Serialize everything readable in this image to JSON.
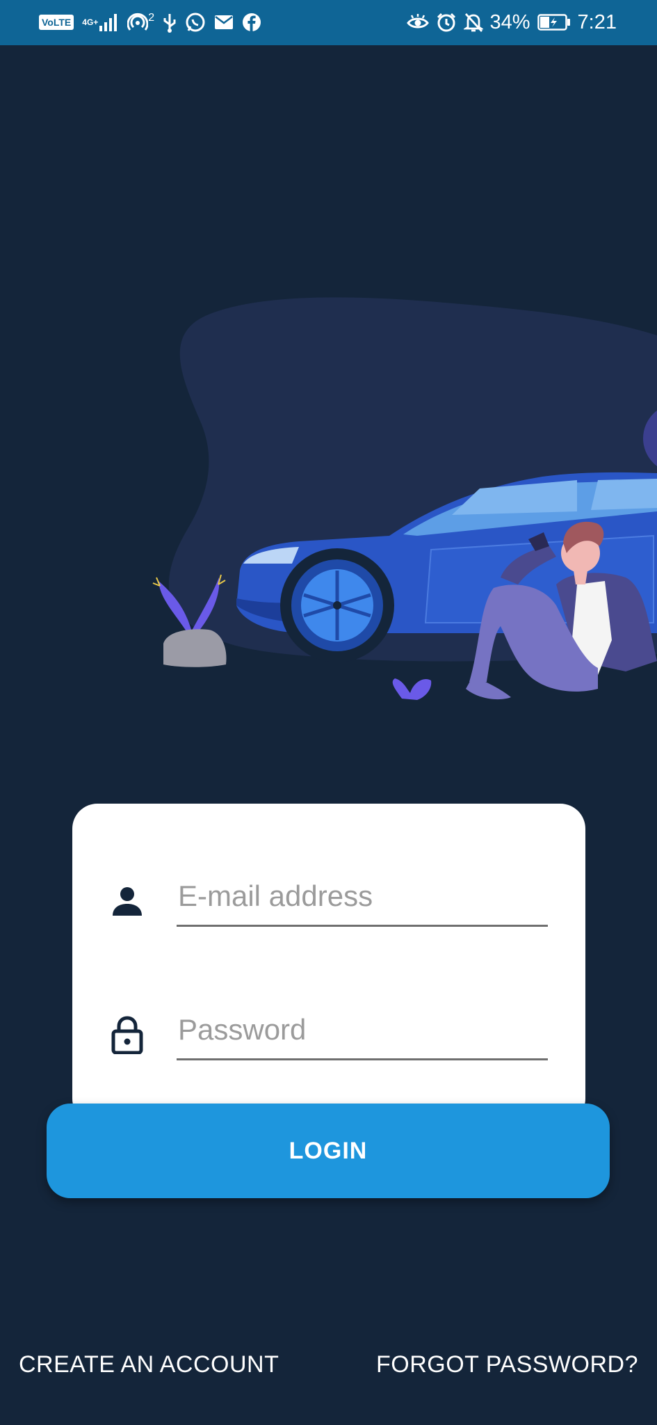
{
  "status_bar": {
    "volte_label": "VoLTE",
    "network_type": "4G+",
    "hotspot_count": "2",
    "battery_percent": "34%",
    "time": "7:21",
    "icons_left": [
      "volte-icon",
      "signal-icon",
      "hotspot-icon",
      "usb-icon",
      "whatsapp-icon",
      "mail-icon",
      "facebook-icon"
    ],
    "icons_right": [
      "eye-comfort-icon",
      "alarm-icon",
      "notifications-off-icon",
      "battery-charging-icon"
    ]
  },
  "login_form": {
    "email_placeholder": "E-mail address",
    "password_placeholder": "Password",
    "login_label": "LOGIN"
  },
  "footer": {
    "create_account_label": "CREATE AN ACCOUNT",
    "forgot_password_label": "FORGOT PASSWORD?"
  },
  "colors": {
    "background": "#14253a",
    "status_bar": "#0f6596",
    "primary_button": "#1e96dd",
    "card": "#ffffff",
    "icon": "#14253a"
  }
}
